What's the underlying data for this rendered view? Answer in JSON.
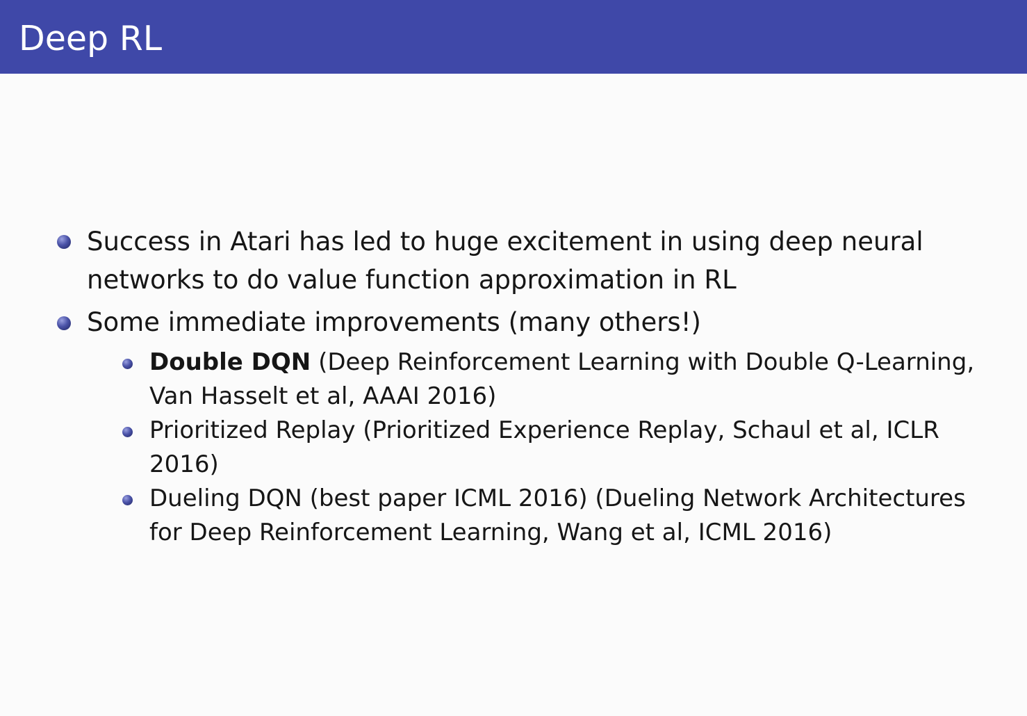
{
  "slide": {
    "title": "Deep RL"
  },
  "bullets": [
    {
      "line1": "Success in Atari has led to huge excitement in using deep neural",
      "line2": "networks to do value function approximation in RL"
    },
    {
      "line1": "Some immediate improvements (many others!)"
    }
  ],
  "subbullets": [
    {
      "bold": "Double DQN",
      "line1_rest": " (Deep Reinforcement Learning with Double Q-Learning,",
      "line2": "Van Hasselt et al, AAAI 2016)"
    },
    {
      "line1": "Prioritized Replay (Prioritized Experience Replay, Schaul et al, ICLR",
      "line2": "2016)"
    },
    {
      "line1": "Dueling DQN (best paper ICML 2016) (Dueling Network Architectures",
      "line2": "for Deep Reinforcement Learning, Wang et al, ICML 2016)"
    }
  ]
}
